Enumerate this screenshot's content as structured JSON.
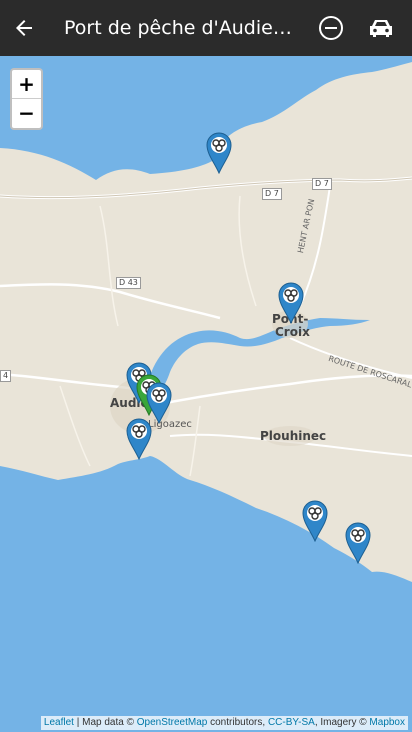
{
  "appbar": {
    "title": "Port de pêche d'Audierne",
    "back_icon": "arrow-left-icon",
    "action_icons": [
      "minus-circle-icon",
      "car-icon"
    ]
  },
  "zoom": {
    "in_label": "+",
    "out_label": "−"
  },
  "map": {
    "places": {
      "audierne": "Audie",
      "esquibien": "Ligoazec",
      "plouhinec": "Plouhinec",
      "pont_croix_1": "Pont-",
      "pont_croix_2": "Croix"
    },
    "roads": {
      "d7_a": "D 7",
      "d7_b": "D 7",
      "d43": "D 43",
      "d4_edge": "4",
      "hent_ar_pon": "HENT AR PON",
      "route_roscaral": "ROUTE DE ROSCARAL"
    },
    "marker_icon": "triskell-marker-icon",
    "colors": {
      "sea": "#74b3e6",
      "land": "#e9e4d8",
      "marker": "#2f86c9",
      "marker_selected": "#3aa63a"
    }
  },
  "attribution": {
    "leaflet": "Leaflet",
    "sep1": " | Map data © ",
    "osm": "OpenStreetMap",
    "sep2": " contributors, ",
    "license": "CC-BY-SA",
    "sep3": ", Imagery © ",
    "mapbox": "Mapbox"
  }
}
